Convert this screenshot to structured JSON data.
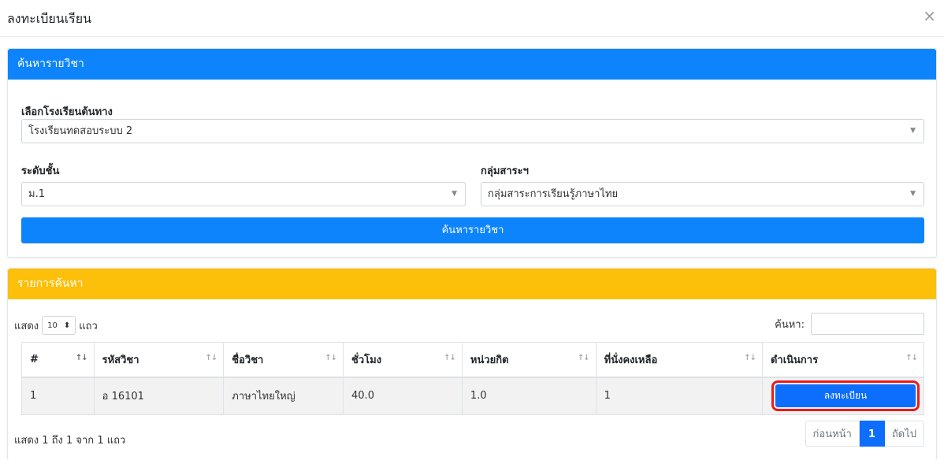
{
  "modal": {
    "title": "ลงทะเบียนเรียน",
    "close": "×"
  },
  "search_card": {
    "header": "ค้นหารายวิชา",
    "school_label": "เลือกโรงเรียนต้นทาง",
    "school_value": "โรงเรียนทดสอบระบบ 2",
    "level_label": "ระดับชั้น",
    "level_value": "ม.1",
    "group_label": "กลุ่มสาระฯ",
    "group_value": "กลุ่มสาระการเรียนรู้ภาษาไทย",
    "caret": "▼",
    "search_button": "ค้นหารายวิชา"
  },
  "results_card": {
    "header": "รายการค้นหา",
    "length_prefix": "แสดง",
    "length_value": "10",
    "length_arrows": "⬍",
    "length_suffix": "แถว",
    "filter_label": "ค้นหา:",
    "columns": [
      "#",
      "รหัสวิชา",
      "ชื่อวิชา",
      "ชั่วโมง",
      "หน่วยกิต",
      "ที่นั่งคงเหลือ",
      "ดำเนินการ"
    ],
    "sort_icon": "↑↓",
    "rows": [
      {
        "no": "1",
        "code": "อ 16101",
        "name": "ภาษาไทยใหญ่",
        "hours": "40.0",
        "credits": "1.0",
        "seats": "1",
        "action": "ลงทะเบียน"
      }
    ],
    "info": "แสดง 1 ถึง 1 จาก 1 แถว",
    "pagination": {
      "prev": "ก่อนหน้า",
      "current": "1",
      "next": "ถัดไป"
    }
  },
  "colors": {
    "search_header": "#0d84fb",
    "results_header": "#fcbf0a",
    "primary_button": "#0d6efd",
    "highlight": "#e81c1c"
  }
}
